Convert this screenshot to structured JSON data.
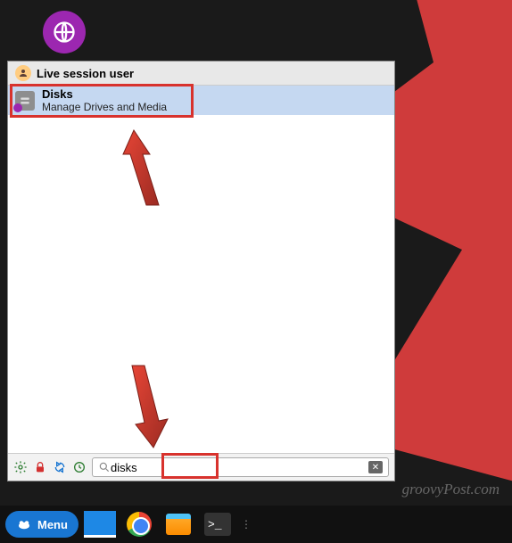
{
  "browser_icon": "globe-icon",
  "menu": {
    "header_user": "Live session user",
    "results": [
      {
        "title": "Disks",
        "desc": "Manage Drives and Media"
      }
    ],
    "footer_icons": [
      "settings",
      "lock",
      "updates",
      "restart"
    ],
    "search": {
      "placeholder": "",
      "value": "disks"
    }
  },
  "taskbar": {
    "menu_label": "Menu",
    "apps": [
      "desktop",
      "chrome",
      "files",
      "terminal"
    ]
  },
  "watermark": "groovyPost.com"
}
